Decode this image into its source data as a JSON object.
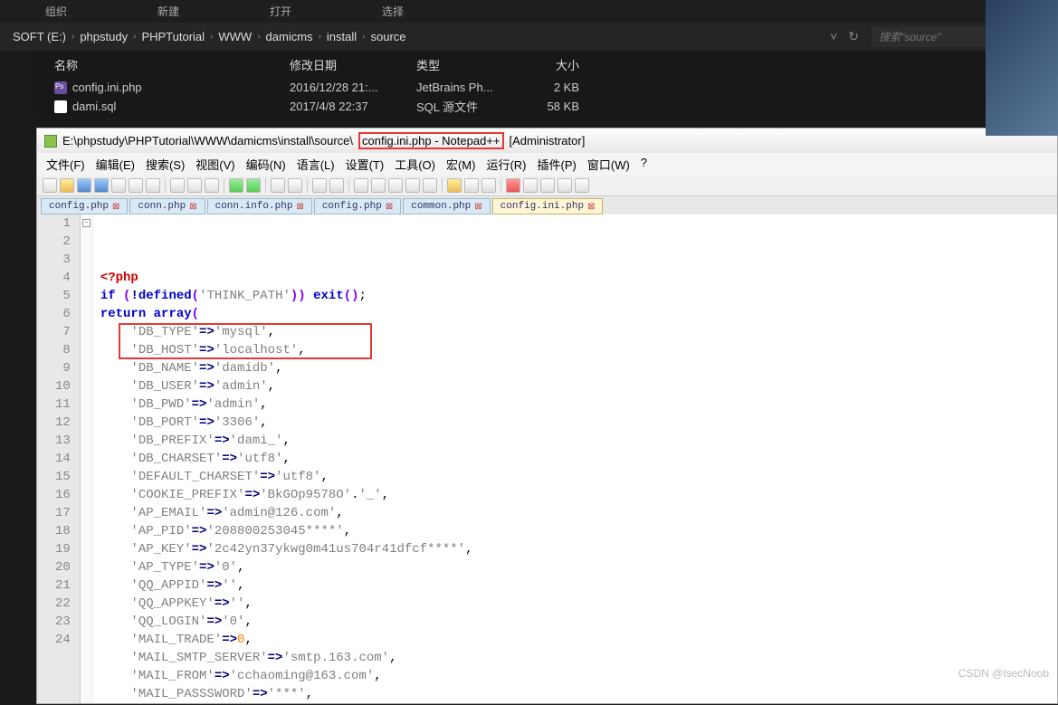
{
  "explorer": {
    "ribbon_tabs": [
      "组织",
      "新建",
      "打开",
      "选择"
    ],
    "breadcrumb": [
      "SOFT (E:)",
      "phpstudy",
      "PHPTutorial",
      "WWW",
      "damicms",
      "install",
      "source"
    ],
    "search_placeholder": "搜索\"source\"",
    "headers": {
      "name": "名称",
      "date": "修改日期",
      "type": "类型",
      "size": "大小"
    },
    "files": [
      {
        "name": "config.ini.php",
        "date": "2016/12/28 21:...",
        "type": "JetBrains Ph...",
        "size": "2 KB",
        "icon": "ps"
      },
      {
        "name": "dami.sql",
        "date": "2017/4/8 22:37",
        "type": "SQL 源文件",
        "size": "58 KB",
        "icon": "sql"
      }
    ]
  },
  "npp": {
    "title_prefix": "E:\\phpstudy\\PHPTutorial\\WWW\\damicms\\install\\source\\",
    "title_file": "config.ini.php - Notepad++",
    "title_suffix": " [Administrator]",
    "menus": [
      "文件(F)",
      "编辑(E)",
      "搜索(S)",
      "视图(V)",
      "编码(N)",
      "语言(L)",
      "设置(T)",
      "工具(O)",
      "宏(M)",
      "运行(R)",
      "插件(P)",
      "窗口(W)",
      "?"
    ],
    "tabs": [
      "config.php",
      "conn.php",
      "conn.info.php",
      "config.php",
      "common.php",
      "config.ini.php"
    ],
    "active_tab": 5,
    "code_lines": [
      {
        "n": 1,
        "html": "<span class='ph'>&lt;?php</span>"
      },
      {
        "n": 2,
        "html": "<span class='kw'>if</span> <span class='br'>(</span><span class='op'>!</span><span class='kw'>defined</span><span class='br'>(</span><span class='str'>'THINK_PATH'</span><span class='br'>))</span> <span class='kw'>exit</span><span class='br'>()</span>;"
      },
      {
        "n": 3,
        "html": "<span class='kw'>return</span> <span class='kw'>array</span><span class='br'>(</span>"
      },
      {
        "n": 4,
        "html": "    <span class='str'>'DB_TYPE'</span><span class='op'>=&gt;</span><span class='str'>'mysql'</span>,"
      },
      {
        "n": 5,
        "html": "    <span class='str'>'DB_HOST'</span><span class='op'>=&gt;</span><span class='str'>'localhost'</span>,"
      },
      {
        "n": 6,
        "html": "    <span class='str'>'DB_NAME'</span><span class='op'>=&gt;</span><span class='str'>'damidb'</span>,"
      },
      {
        "n": 7,
        "html": "    <span class='str'>'DB_USER'</span><span class='op'>=&gt;</span><span class='str'>'admin'</span>,"
      },
      {
        "n": 8,
        "html": "    <span class='str'>'DB_PWD'</span><span class='op'>=&gt;</span><span class='str'>'admin'</span>,"
      },
      {
        "n": 9,
        "html": "    <span class='str'>'DB_PORT'</span><span class='op'>=&gt;</span><span class='str'>'3306'</span>,"
      },
      {
        "n": 10,
        "html": "    <span class='str'>'DB_PREFIX'</span><span class='op'>=&gt;</span><span class='str'>'dami_'</span>,"
      },
      {
        "n": 11,
        "html": "    <span class='str'>'DB_CHARSET'</span><span class='op'>=&gt;</span><span class='str'>'utf8'</span>,"
      },
      {
        "n": 12,
        "html": "    <span class='str'>'DEFAULT_CHARSET'</span><span class='op'>=&gt;</span><span class='str'>'utf8'</span>,"
      },
      {
        "n": 13,
        "html": "    <span class='str'>'COOKIE_PREFIX'</span><span class='op'>=&gt;</span><span class='str'>'BkGOp9578O'</span>.<span class='str'>'_'</span>,"
      },
      {
        "n": 14,
        "html": "    <span class='str'>'AP_EMAIL'</span><span class='op'>=&gt;</span><span class='str'>'admin@126.com'</span>,"
      },
      {
        "n": 15,
        "html": "    <span class='str'>'AP_PID'</span><span class='op'>=&gt;</span><span class='str'>'208800253045****'</span>,"
      },
      {
        "n": 16,
        "html": "    <span class='str'>'AP_KEY'</span><span class='op'>=&gt;</span><span class='str'>'2c42yn37ykwg0m41us704r41dfcf****'</span>,"
      },
      {
        "n": 17,
        "html": "    <span class='str'>'AP_TYPE'</span><span class='op'>=&gt;</span><span class='str'>'0'</span>,"
      },
      {
        "n": 18,
        "html": "    <span class='str'>'QQ_APPID'</span><span class='op'>=&gt;</span><span class='str'>''</span>,"
      },
      {
        "n": 19,
        "html": "    <span class='str'>'QQ_APPKEY'</span><span class='op'>=&gt;</span><span class='str'>''</span>,"
      },
      {
        "n": 20,
        "html": "    <span class='str'>'QQ_LOGIN'</span><span class='op'>=&gt;</span><span class='str'>'0'</span>,"
      },
      {
        "n": 21,
        "html": "    <span class='str'>'MAIL_TRADE'</span><span class='op'>=&gt;</span><span class='num'>0</span>,"
      },
      {
        "n": 22,
        "html": "    <span class='str'>'MAIL_SMTP_SERVER'</span><span class='op'>=&gt;</span><span class='str'>'smtp.163.com'</span>,"
      },
      {
        "n": 23,
        "html": "    <span class='str'>'MAIL_FROM'</span><span class='op'>=&gt;</span><span class='str'>'cchaoming@163.com'</span>,"
      },
      {
        "n": 24,
        "html": "    <span class='str'>'MAIL_PASSSWORD'</span><span class='op'>=&gt;</span><span class='str'>'***'</span>,"
      }
    ]
  },
  "watermark": "CSDN @IsecNoob"
}
